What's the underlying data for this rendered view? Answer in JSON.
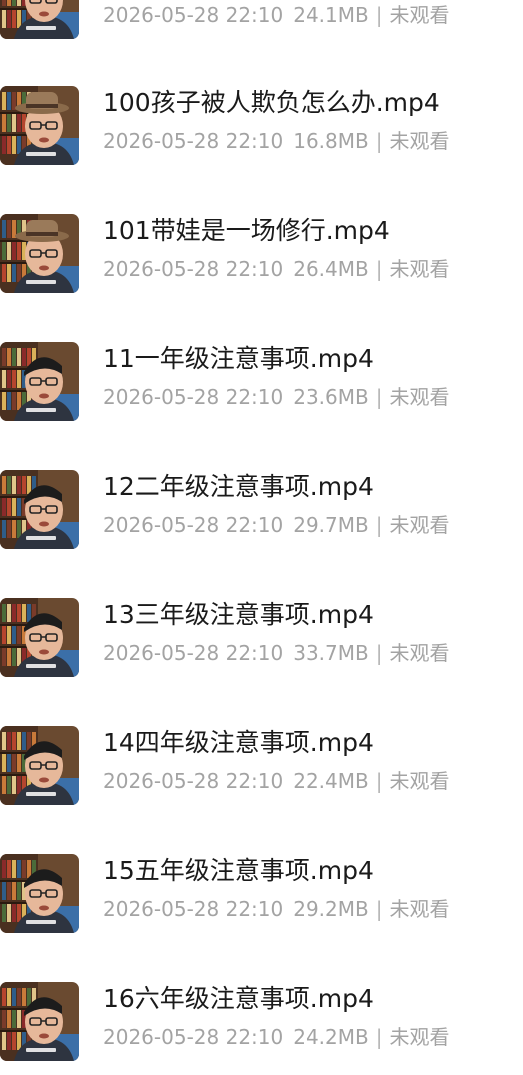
{
  "items": [
    {
      "title": "",
      "date": "2026-05-28 22:10",
      "size": "24.1MB",
      "sep": "|",
      "status": "未观看",
      "thumb_variant": "hat"
    },
    {
      "title": "100孩子被人欺负怎么办.mp4",
      "date": "2026-05-28 22:10",
      "size": "16.8MB",
      "sep": "|",
      "status": "未观看",
      "thumb_variant": "hat"
    },
    {
      "title": "101带娃是一场修行.mp4",
      "date": "2026-05-28 22:10",
      "size": "26.4MB",
      "sep": "|",
      "status": "未观看",
      "thumb_variant": "hat"
    },
    {
      "title": "11一年级注意事项.mp4",
      "date": "2026-05-28 22:10",
      "size": "23.6MB",
      "sep": "|",
      "status": "未观看",
      "thumb_variant": "plain"
    },
    {
      "title": "12二年级注意事项.mp4",
      "date": "2026-05-28 22:10",
      "size": "29.7MB",
      "sep": "|",
      "status": "未观看",
      "thumb_variant": "plain"
    },
    {
      "title": "13三年级注意事项.mp4",
      "date": "2026-05-28 22:10",
      "size": "33.7MB",
      "sep": "|",
      "status": "未观看",
      "thumb_variant": "plain"
    },
    {
      "title": "14四年级注意事项.mp4",
      "date": "2026-05-28 22:10",
      "size": "22.4MB",
      "sep": "|",
      "status": "未观看",
      "thumb_variant": "plain"
    },
    {
      "title": "15五年级注意事项.mp4",
      "date": "2026-05-28 22:10",
      "size": "29.2MB",
      "sep": "|",
      "status": "未观看",
      "thumb_variant": "plain"
    },
    {
      "title": "16六年级注意事项.mp4",
      "date": "2026-05-28 22:10",
      "size": "24.2MB",
      "sep": "|",
      "status": "未观看",
      "thumb_variant": "plain"
    }
  ],
  "colors": {
    "title": "#1a1a1a",
    "meta": "#a3a3a3",
    "background": "#ffffff"
  }
}
